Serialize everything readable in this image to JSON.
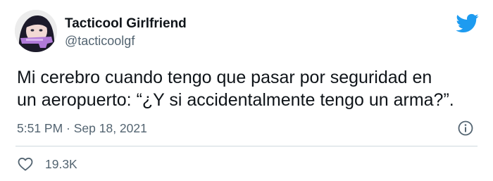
{
  "author": {
    "display_name": "Tacticool Girlfriend",
    "handle": "@tacticoolgf",
    "avatar_icon": "avatar-image"
  },
  "tweet": {
    "text": "Mi cerebro cuando tengo que pasar por seguridad en\nun aeropuerto: “¿Y si accidentalmente tengo un arma?”.",
    "timestamp": "5:51 PM · Sep 18, 2021",
    "likes": "19.3K"
  },
  "icons": {
    "logo": "twitter-bird-icon",
    "info": "info-icon",
    "like": "heart-icon"
  },
  "colors": {
    "brand": "#1d9bf0",
    "text": "#0f1419",
    "secondary_text": "#536471",
    "divider": "#cfd9de"
  }
}
